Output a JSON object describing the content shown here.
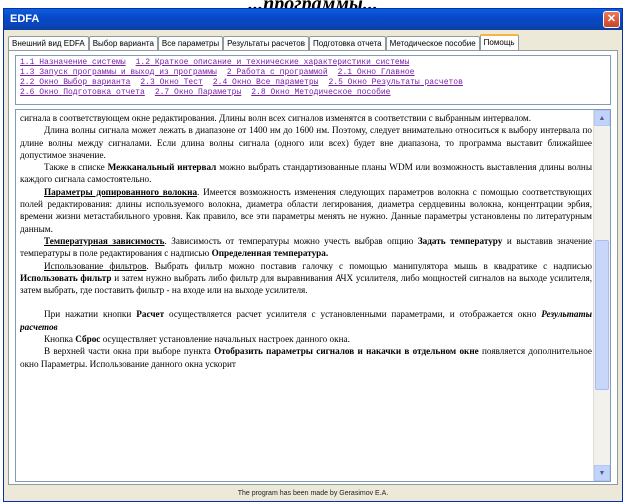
{
  "caption": "...программы...",
  "window": {
    "title": "EDFA",
    "close_glyph": "✕"
  },
  "tabs": [
    {
      "label": "Внешний вид EDFA"
    },
    {
      "label": "Выбор варианта"
    },
    {
      "label": "Все параметры"
    },
    {
      "label": "Результаты расчетов"
    },
    {
      "label": "Подготовка отчета"
    },
    {
      "label": "Методическое пособие"
    },
    {
      "label": "Помощь"
    }
  ],
  "help_links": [
    "1.1 Назначение системы",
    "1.2 Краткое описание и технические характеристики системы",
    "1.3 Запуск программы и выход из программы",
    "2 Работа с программой",
    "2.1 Окно Главное",
    "2.2 Окно Выбор варианта",
    "2.3 Окно Тест",
    "2.4 Окно Все параметры",
    "2.5 Окно Результаты расчетов",
    "2.6 Окно Подготовка отчета",
    "2.7 Окно Параметры",
    "2.8 Окно Методическое пособие"
  ],
  "doc": {
    "p0": "сигнала в соответствующем окне редактирования. Длины волн всех сигналов изменятся в соответствии с выбранным интервалом.",
    "p1": "Длина волны сигнала может лежать в диапазоне от 1400 нм до 1600 нм. Поэтому, следует внимательно относиться к выбору интервала по длине волны между сигналами. Если длина волны сигнала (одного или всех) будет вне диапазона, то программа выставит ближайшее допустимое значение.",
    "p2a": "Также в списке ",
    "p2b": "Межканальный интервал",
    "p2c": " можно выбрать стандартизованные планы WDM или возможность выставления длины волны каждого сигнала самостоятельно.",
    "p3a": "Параметры допированного волокна",
    "p3b": ". Имеется возможность изменения следующих параметров волокна с помощью соответствующих полей редактирования: длины используемого волокна, диаметра области легирования, диаметра сердцевины волокна, концентрации эрбия, времени жизни метастабильного уровня. Как правило, все эти параметры менять не нужно. Данные параметры установлены по литературным данным.",
    "p4a": "Температурная зависимость",
    "p4b": ". Зависимость от температуры можно учесть выбрав опцию ",
    "p4c": "Задать температуру",
    "p4d": " и выставив значение температуры в поле редактирования с надписью ",
    "p4e": "Определенная температура.",
    "p5a": "Использование фильтров",
    "p5b": ". Выбрать фильтр можно поставив галочку с помощью манипулятора мышь в квадратике с надписью ",
    "p5c": "Использовать фильтр",
    "p5d": " и затем нужно выбрать либо фильтр для выравнивания АЧХ усилителя, либо мощностей сигналов на выходе усилителя, затем выбрать, где поставить фильтр - на входе или на выходе усилителя.",
    "p6a": "При нажатии кнопки ",
    "p6b": "Расчет",
    "p6c": " осуществляется расчет усилителя с установленными параметрами, и отображается окно ",
    "p6d": "Результаты расчетов",
    "p7a": "Кнопка ",
    "p7b": "Сброс",
    "p7c": " осуществляет установление начальных настроек данного окна.",
    "p8a": "В верхней части окна при выборе пункта ",
    "p8b": "Отобразить параметры сигналов и накачки в отдельном окне",
    "p8c": " появляется дополнительное окно Параметры. Использование данного окна ускорит"
  },
  "status": "The program has been made by Gerasimov E.A.",
  "colors": {
    "titlebar": "#0848c8",
    "link": "#7a1fa8",
    "active_tab": "#f7b442"
  }
}
